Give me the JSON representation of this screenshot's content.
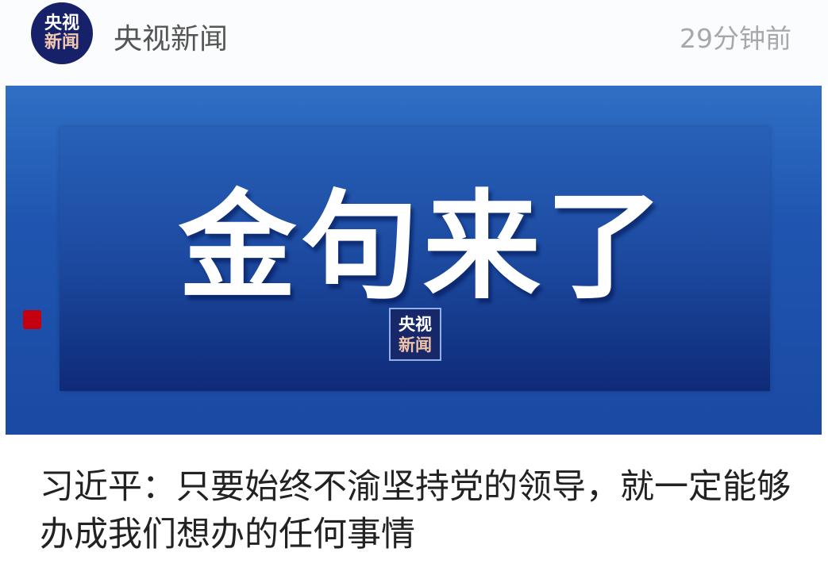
{
  "header": {
    "avatar_logo": [
      "央视",
      "新闻"
    ],
    "source_name": "央视新闻",
    "time_ago": "29分钟前"
  },
  "banner": {
    "title": "金句来了",
    "logo": [
      "央视",
      "新闻"
    ]
  },
  "article": {
    "headline": "习近平：只要始终不渝坚持党的领导，就一定能够办成我们想办的任何事情"
  }
}
